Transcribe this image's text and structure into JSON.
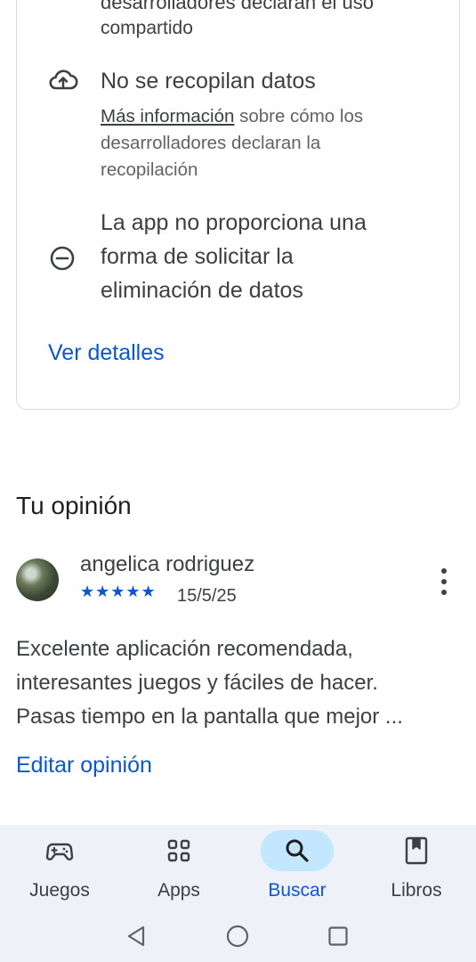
{
  "data_safety": {
    "cut_line": "desarrolladores declaran el uso",
    "shared_line": "compartido",
    "no_collect": {
      "icon": "cloud-upload-icon",
      "title": "No se recopilan datos",
      "link_text": "Más información",
      "sub_rest_1": " sobre cómo los",
      "sub_line_2": "desarrolladores declaran la",
      "sub_line_3": "recopilación"
    },
    "deletion": {
      "icon": "minus-circle-icon",
      "line_1": "La app no proporciona una",
      "line_2": "forma de solicitar la",
      "line_3": "eliminación de datos"
    },
    "details_link": "Ver detalles"
  },
  "review": {
    "section_title": "Tu opinión",
    "reviewer_name": "angelica rodriguez",
    "stars": "★★★★★",
    "rating": 5,
    "date": "15/5/25",
    "text_line_1": "Excelente aplicación recomendada,",
    "text_line_2": "interesantes juegos y fáciles de hacer.",
    "text_line_3": "Pasas tiempo en la pantalla que mejor ...",
    "edit_link": "Editar opinión"
  },
  "bottom_nav": {
    "items": [
      {
        "label": "Juegos",
        "icon": "gamepad-icon"
      },
      {
        "label": "Apps",
        "icon": "apps-grid-icon"
      },
      {
        "label": "Buscar",
        "icon": "search-icon",
        "active": true
      },
      {
        "label": "Libros",
        "icon": "bookmark-book-icon"
      }
    ]
  },
  "colors": {
    "accent": "#0b57d0",
    "active_pill": "#c2e7ff",
    "nav_bg": "#eef1f8"
  }
}
